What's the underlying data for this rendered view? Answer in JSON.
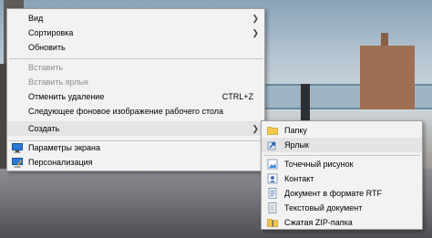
{
  "main_menu": {
    "items": [
      {
        "label": "Вид",
        "arrow": "❯"
      },
      {
        "label": "Сортировка",
        "arrow": "❯"
      },
      {
        "label": "Обновить"
      },
      {
        "label": "Вставить"
      },
      {
        "label": "Вставить ярлык"
      },
      {
        "label": "Отменить удаление",
        "shortcut": "CTRL+Z"
      },
      {
        "label": "Следующее фоновое изображение рабочего стола"
      },
      {
        "label": "Создать",
        "arrow": "❯"
      },
      {
        "label": "Параметры экрана",
        "icon": "display-settings-icon"
      },
      {
        "label": "Персонализация",
        "icon": "personalize-icon"
      }
    ]
  },
  "sub_menu": {
    "items": [
      {
        "label": "Папку",
        "icon": "folder-icon"
      },
      {
        "label": "Ярлык",
        "icon": "shortcut-icon"
      },
      {
        "label": "Точечный рисунок",
        "icon": "bitmap-icon"
      },
      {
        "label": "Контакт",
        "icon": "contact-icon"
      },
      {
        "label": "Документ в формате RTF",
        "icon": "rtf-document-icon"
      },
      {
        "label": "Текстовый документ",
        "icon": "text-document-icon"
      },
      {
        "label": "Сжатая ZIP-папка",
        "icon": "zip-folder-icon"
      }
    ]
  },
  "colors": {
    "menu_bg": "#f2f2f2",
    "highlight": "#e4e4e4",
    "disabled_text": "#8d8d8d"
  }
}
